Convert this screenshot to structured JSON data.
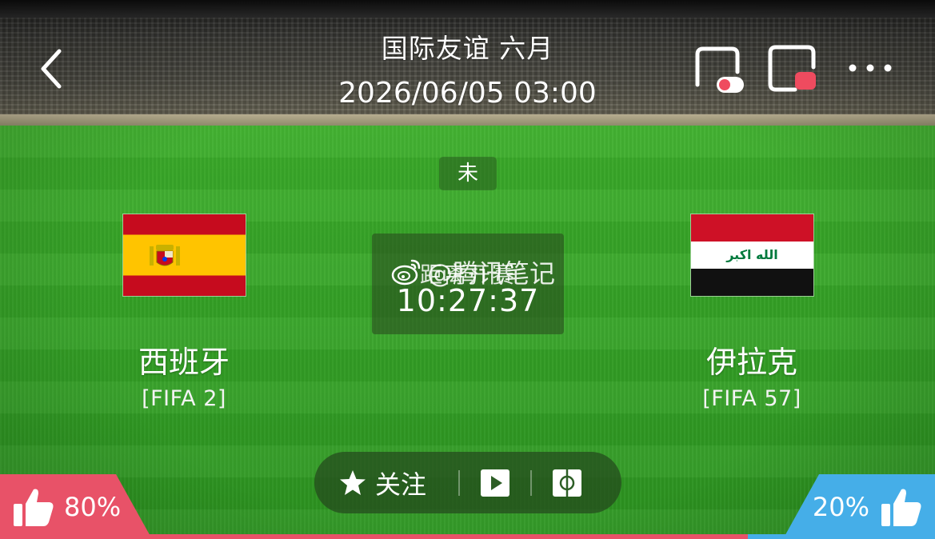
{
  "header": {
    "title": "国际友谊 六月",
    "datetime": "2026/06/05 03:00"
  },
  "icons": {
    "back": "chevron-left-icon",
    "pip": "picture-in-picture-icon",
    "float": "floating-window-icon",
    "more": "more-dots-icon",
    "follow": "star-icon",
    "play": "play-icon",
    "field": "pitch-icon",
    "vote": "thumbs-up-icon"
  },
  "match": {
    "status": "未",
    "countdown_label": "距离开赛",
    "countdown": "10:27:37"
  },
  "watermark": {
    "text": "@腾讯笔记",
    "icon": "weibo-icon"
  },
  "home_team": {
    "name": "西班牙",
    "rank": "[FIFA 2]",
    "flag": "spain-flag"
  },
  "away_team": {
    "name": "伊拉克",
    "rank": "[FIFA 57]",
    "flag": "iraq-flag",
    "flag_inscription": "الله اكبر"
  },
  "actions": {
    "follow_label": "关注"
  },
  "votes": {
    "home_pct": "80%",
    "away_pct": "20%",
    "home_share": 0.8,
    "away_share": 0.2
  },
  "colors": {
    "home_vote": "#e85268",
    "away_vote": "#45aee8",
    "pitch": "#35a326",
    "accent_red": "#ef4b5f"
  }
}
